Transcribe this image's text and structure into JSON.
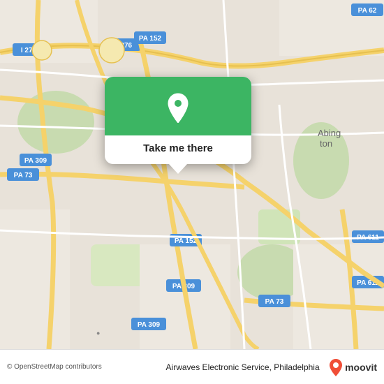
{
  "map": {
    "attribution": "© OpenStreetMap contributors",
    "popup": {
      "button_label": "Take me there"
    },
    "pin_icon": "map-pin"
  },
  "bottom_bar": {
    "location_text": "Airwaves Electronic Service, Philadelphia",
    "attribution": "© OpenStreetMap contributors"
  },
  "brand": {
    "name": "moovit",
    "accent_color": "#f04e37"
  }
}
